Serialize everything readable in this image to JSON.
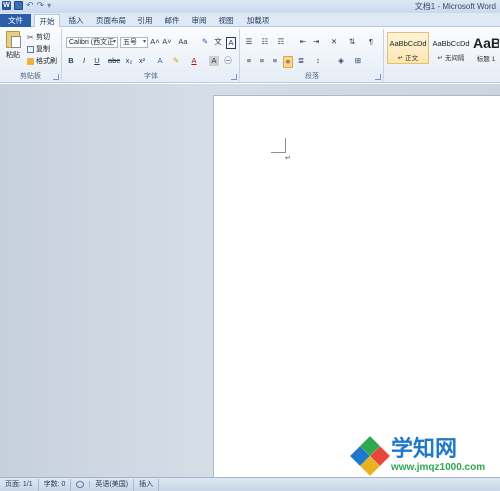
{
  "window": {
    "title": "文档1 - Microsoft Word"
  },
  "tabs": [
    {
      "label": "文件"
    },
    {
      "label": "开始"
    },
    {
      "label": "插入"
    },
    {
      "label": "页面布局"
    },
    {
      "label": "引用"
    },
    {
      "label": "邮件"
    },
    {
      "label": "审阅"
    },
    {
      "label": "视图"
    },
    {
      "label": "加载项"
    }
  ],
  "clipboard": {
    "paste_label": "粘贴",
    "cut_label": "剪切",
    "copy_label": "复制",
    "format_painter_label": "格式刷",
    "group_label": "剪贴板"
  },
  "font": {
    "font_name": "Calibri (西文正",
    "font_size": "五号",
    "group_label": "字体"
  },
  "paragraph": {
    "group_label": "段落"
  },
  "styles": [
    {
      "sample": "AaBbCcDd",
      "name": "↵ 正文"
    },
    {
      "sample": "AaBbCcDd",
      "name": "↵ 无间隔"
    },
    {
      "sample": "AaB",
      "name": "标题 1"
    }
  ],
  "status": {
    "page": "页面: 1/1",
    "words": "字数: 0",
    "language": "英语(美国)",
    "mode": "插入"
  },
  "watermark": {
    "title": "学知网",
    "url": "www.jmqz1000.com"
  },
  "document": {
    "para_mark": "↵"
  }
}
